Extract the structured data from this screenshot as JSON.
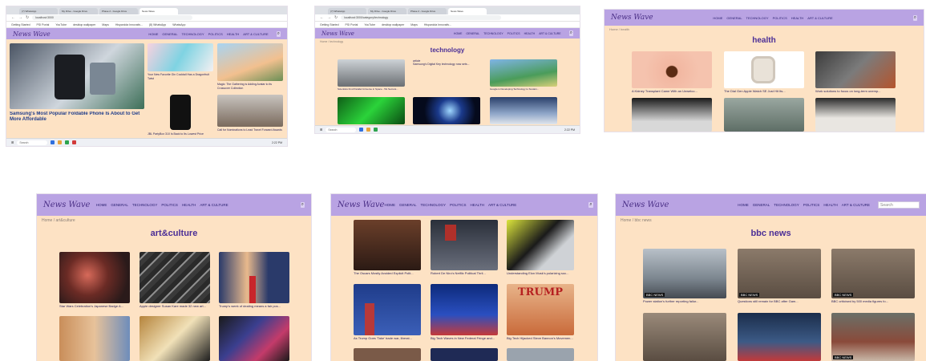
{
  "site": {
    "logo": "News Wave",
    "nav": [
      "HOME",
      "GENERAL",
      "TECHNOLOGY",
      "POLITICS",
      "HEALTH",
      "ART & CULTURE"
    ],
    "search_placeholder": "Search"
  },
  "browser": {
    "tabs": [
      "(7) WhatsApp",
      "My Drive - Google Drive",
      "Phase 2 - Google Drive",
      "News Wave"
    ],
    "url_home": "localhost:3000",
    "url_tech": "localhost:3000/category/technology",
    "bookmarks": [
      "Getting Started",
      "PSI Portal",
      "YouTube",
      "desktop wallpaper",
      "Maps",
      "Hispaniola Innovativ...",
      "(8) WhatsApp",
      "WhatsApp"
    ],
    "taskbar_search": "Search",
    "taskbar_time": "2:22 PM"
  },
  "panel_home": {
    "hero_caption": "Samsung's Most Popular Foldable Phone Is About to Get More Affordable",
    "cards": [
      "Your New Favorite Gin Cocktail Has a Dragonfruit Twist",
      "Magic: The Gathering is Adding Avatar to its Crossover Collection",
      "JBL PartyBox 310 Is Back to Its Lowest Price",
      "Call for Nominations to Lead Travel Forward Awards"
    ]
  },
  "panel_tech": {
    "breadcrumb": "Home / technology",
    "title": "technology",
    "article_label": "article",
    "article_text": "Samsung's Digital Key technology now sets...",
    "cards": [
      "Scientists Find Parallel Universe in Space - 5G Secrets...",
      "Google is Developing Technology to Sustain...",
      "",
      "",
      ""
    ]
  },
  "panel_health": {
    "breadcrumb": "Home / health",
    "title": "health",
    "cards": [
      "A Kidney Transplant Came With an Unwelco...",
      "The Dial Gen Apple Watch SE Just Hit Its...",
      "Work solutions to focus on long-term unemp...",
      "",
      "",
      ""
    ]
  },
  "panel_art": {
    "breadcrumb": "Home / art&culture",
    "title": "art&culture",
    "cards": [
      "Star Wars Celebration's Japanese Badge A...",
      "Apple designer Susan Kare made 32 new art...",
      "Trump's week of dealing means a fair pos...",
      "",
      "",
      ""
    ]
  },
  "panel_politics": {
    "cards": [
      "The Oscars Mostly Avoided Explicit Polit...",
      "Robert De Niro's Netflix Political Thril...",
      "Understanding Elon Musk's polarizing soc...",
      "As Trump Goes 'Take' trade war, liberat...",
      "Big Tech Waves in New Federal Fringe and...",
      "Big Tech Hijacked Steve Bannon's Movemen...",
      "",
      "",
      ""
    ],
    "magazine_title": "TRUMP"
  },
  "panel_bbc": {
    "breadcrumb": "Home / bbc news",
    "title": "bbc news",
    "badge": "BBC NEWS",
    "cards": [
      "Power station's further reporting failur...",
      "Questions still remain for BBC after Gam...",
      "BBC criticised by 500 media figures fo...",
      "",
      "",
      ""
    ]
  },
  "colors": {
    "header": "#b9a3e3",
    "page_bg": "#fde2c4",
    "title": "#4b2e96",
    "logo": "#4a2f86"
  }
}
